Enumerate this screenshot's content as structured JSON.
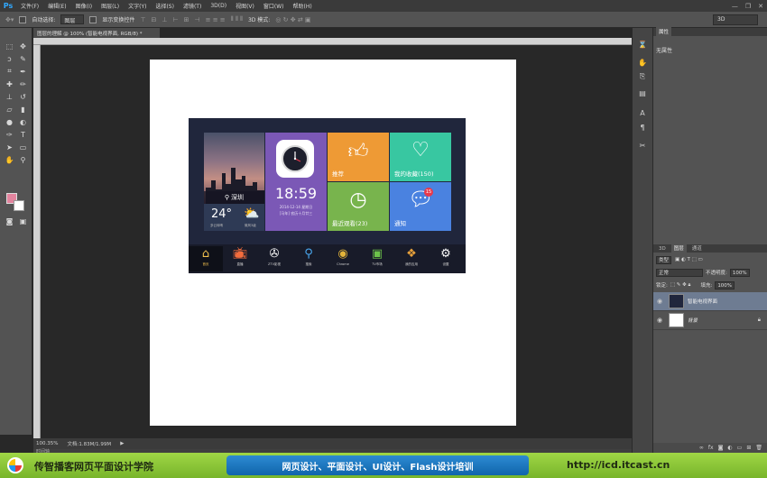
{
  "app": {
    "logo": "Ps"
  },
  "menu": [
    "文件(F)",
    "编辑(E)",
    "图像(I)",
    "图层(L)",
    "文字(Y)",
    "选择(S)",
    "滤镜(T)",
    "3D(D)",
    "视图(V)",
    "窗口(W)",
    "帮助(H)"
  ],
  "window_controls": [
    "—",
    "❐",
    "✕"
  ],
  "options": {
    "auto_select_label": "自动选择:",
    "auto_select_value": "图层",
    "show_transform_label": "显示变换控件",
    "mode_3d_label": "3D 模式:",
    "workspace": "3D"
  },
  "document": {
    "tab_title": "图层的理解 @ 100% (智能电视界面, RGB/8) *",
    "zoom": "100.35%",
    "doc_info": "文档:1.83M/1.99M",
    "timeline_label": "时间轴"
  },
  "colors": {
    "foreground": "#e3849e",
    "background": "#ffffff",
    "accent": "#31a8ff"
  },
  "tv": {
    "city": "深圳",
    "temperature": "24°",
    "weather_sub1": "多云转晴",
    "weather_sub2": "微风3级",
    "time": "18:59",
    "date": "2014-12-14  星期日",
    "lunar": "[马年] 农历十月廿三",
    "tiles": {
      "recommend": "推荐",
      "favorites": "我的收藏(150)",
      "recent": "最近观看(23)",
      "notify": "通知",
      "notify_badge": "15"
    },
    "dock": [
      {
        "label": "首页",
        "icon": "home-icon"
      },
      {
        "label": "直播",
        "icon": "tv-icon"
      },
      {
        "label": "ZTV影视",
        "icon": "film-reel-icon"
      },
      {
        "label": "搜索",
        "icon": "search-icon"
      },
      {
        "label": "Chrome",
        "icon": "chrome-icon"
      },
      {
        "label": "TV市场",
        "icon": "tv-market-icon"
      },
      {
        "label": "我的应用",
        "icon": "apps-icon"
      },
      {
        "label": "设置",
        "icon": "gear-icon"
      }
    ]
  },
  "panels": {
    "properties_tab": "属性",
    "properties_empty": "无属性",
    "tabs_lower": [
      "3D",
      "图层",
      "通道"
    ],
    "filter_kind": "类型",
    "blend_mode": "正常",
    "opacity_label": "不透明度:",
    "opacity_value": "100%",
    "lock_label": "锁定:",
    "fill_label": "填充:",
    "fill_value": "100%",
    "layers": [
      {
        "name": "智能电视界面",
        "selected": true
      },
      {
        "name": "背景",
        "selected": false,
        "locked": true
      }
    ]
  },
  "banner": {
    "left": "传智播客网页平面设计学院",
    "middle": "网页设计、平面设计、UI设计、Flash设计培训",
    "right": "http://icd.itcast.cn"
  }
}
